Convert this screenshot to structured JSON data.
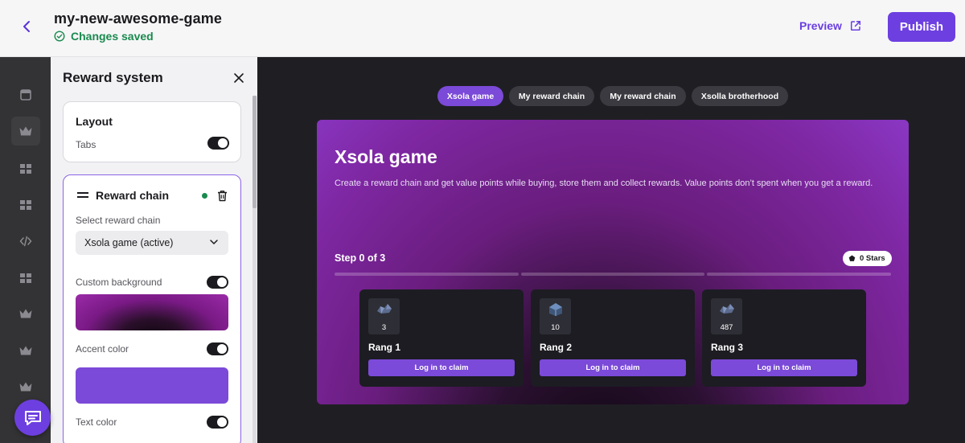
{
  "header": {
    "project_title": "my-new-awesome-game",
    "status_text": "Changes saved",
    "preview_label": "Preview",
    "publish_label": "Publish"
  },
  "rail": {
    "items": [
      "store-icon",
      "crown-icon",
      "grid-icon",
      "grid-icon",
      "code-icon",
      "grid-icon",
      "crown-icon",
      "crown-icon",
      "crown-icon"
    ],
    "active_index": 1
  },
  "panel": {
    "title": "Reward system",
    "layout": {
      "title": "Layout",
      "tabs_label": "Tabs",
      "tabs_enabled": true
    },
    "reward_chain": {
      "title": "Reward chain",
      "select_label": "Select reward chain",
      "selected_value": "Xsola game (active)",
      "custom_background_label": "Custom background",
      "custom_background_enabled": true,
      "accent_color_label": "Accent color",
      "accent_color_enabled": true,
      "accent_color": "#7b4ad8",
      "text_color_label": "Text color",
      "text_color_enabled": true
    }
  },
  "preview": {
    "tabs": [
      {
        "label": "Xsola game",
        "active": true
      },
      {
        "label": "My reward chain",
        "active": false
      },
      {
        "label": "My reward chain",
        "active": false
      },
      {
        "label": "Xsolla brotherhood",
        "active": false
      }
    ],
    "banner": {
      "title": "Xsola game",
      "description": "Create a reward chain and get value points while buying, store them and collect rewards. Value points don’t spent when you get a reward.",
      "step_label": "Step 0 of 3",
      "stars_label": "0 Stars",
      "progress_steps_completed": 0,
      "progress_steps_total": 3
    },
    "rewards": [
      {
        "count": "3",
        "name": "Rang 1",
        "button": "Log in to claim"
      },
      {
        "count": "10",
        "name": "Rang 2",
        "button": "Log in to claim"
      },
      {
        "count": "487",
        "name": "Rang 3",
        "button": "Log in to claim"
      }
    ]
  },
  "colors": {
    "brand_purple": "#6d3fe0",
    "accent": "#7b4ad8",
    "success_green": "#1a8a4e"
  }
}
